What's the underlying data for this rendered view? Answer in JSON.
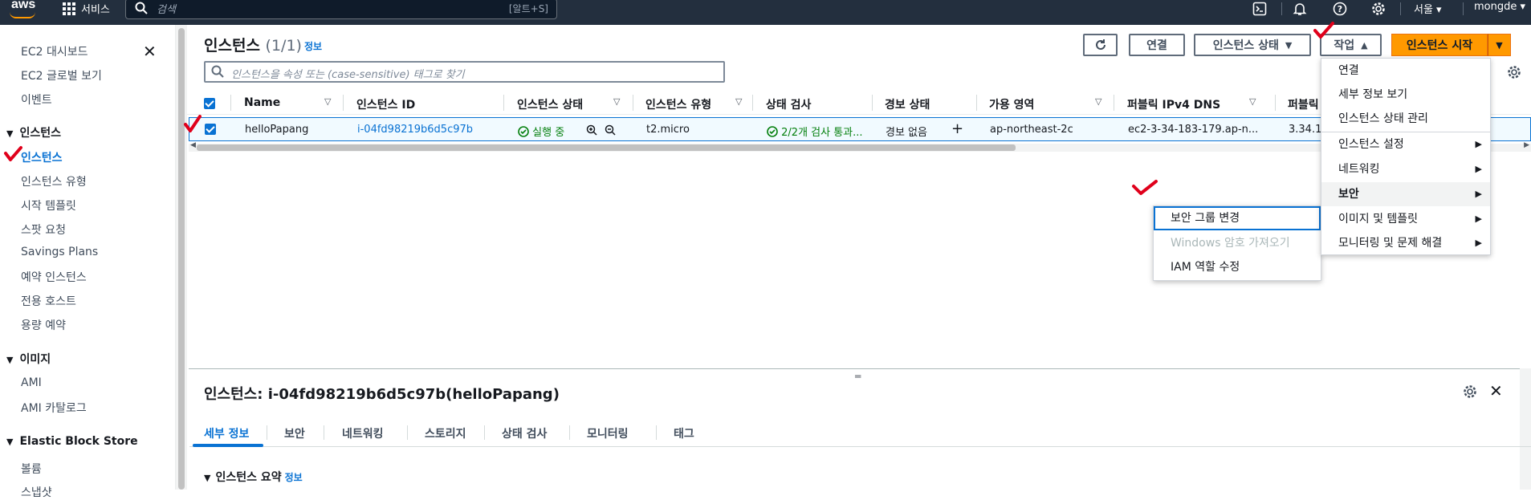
{
  "topbar": {
    "logo": "aws",
    "services_label": "서비스",
    "search_placeholder": "검색",
    "search_shortcut": "[알트+S]",
    "region": "서울 ▾",
    "user": "mongde ▾"
  },
  "sidebar": {
    "items_top": [
      "EC2 대시보드",
      "EC2 글로벌 보기",
      "이벤트"
    ],
    "section_instances": "인스턴스",
    "items_instances": [
      "인스턴스",
      "인스턴스 유형",
      "시작 템플릿",
      "스팟 요청",
      "Savings Plans",
      "예약 인스턴스",
      "전용 호스트",
      "용량 예약"
    ],
    "section_images": "이미지",
    "items_images": [
      "AMI",
      "AMI 카탈로그"
    ],
    "section_ebs": "Elastic Block Store",
    "items_ebs": [
      "볼륨",
      "스냅샷"
    ]
  },
  "header": {
    "title": "인스턴스",
    "count": "(1/1)",
    "info": "정보",
    "connect": "연결",
    "instance_state": "인스턴스 상태",
    "actions": "작업",
    "launch": "인스턴스 시작",
    "filter_placeholder": "인스턴스을 속성 또는 (case-sensitive) 태그로 찾기"
  },
  "table": {
    "columns": [
      "Name",
      "인스턴스 ID",
      "인스턴스 상태",
      "인스턴스 유형",
      "상태 검사",
      "경보 상태",
      "가용 영역",
      "퍼블릭 IPv4 DNS",
      "퍼블릭"
    ],
    "row": {
      "name": "helloPapang",
      "id": "i-04fd98219b6d5c97b",
      "state": "실행 중",
      "type": "t2.micro",
      "check": "2/2개 검사 통과...",
      "alarm": "경보 없음",
      "az": "ap-northeast-2c",
      "dns": "ec2-3-34-183-179.ap-n...",
      "ip": "3.34.1"
    }
  },
  "actions_menu": {
    "items": [
      "연결",
      "세부 정보 보기",
      "인스턴스 상태 관리",
      "인스턴스 설정",
      "네트워킹",
      "보안",
      "이미지 및 템플릿",
      "모니터링 및 문제 해결"
    ]
  },
  "security_submenu": {
    "items": [
      "보안 그룹 변경",
      "Windows 암호 가져오기",
      "IAM 역할 수정"
    ]
  },
  "detail": {
    "title": "인스턴스: i-04fd98219b6d5c97b(helloPapang)",
    "tabs": [
      "세부 정보",
      "보안",
      "네트워킹",
      "스토리지",
      "상태 검사",
      "모니터링",
      "태그"
    ],
    "summary": "인스턴스 요약",
    "summary_info": "정보"
  },
  "colors": {
    "accent": "#0972d3",
    "primary": "#ff9900",
    "annotation": "#e0001b",
    "nav": "#232f3e"
  }
}
